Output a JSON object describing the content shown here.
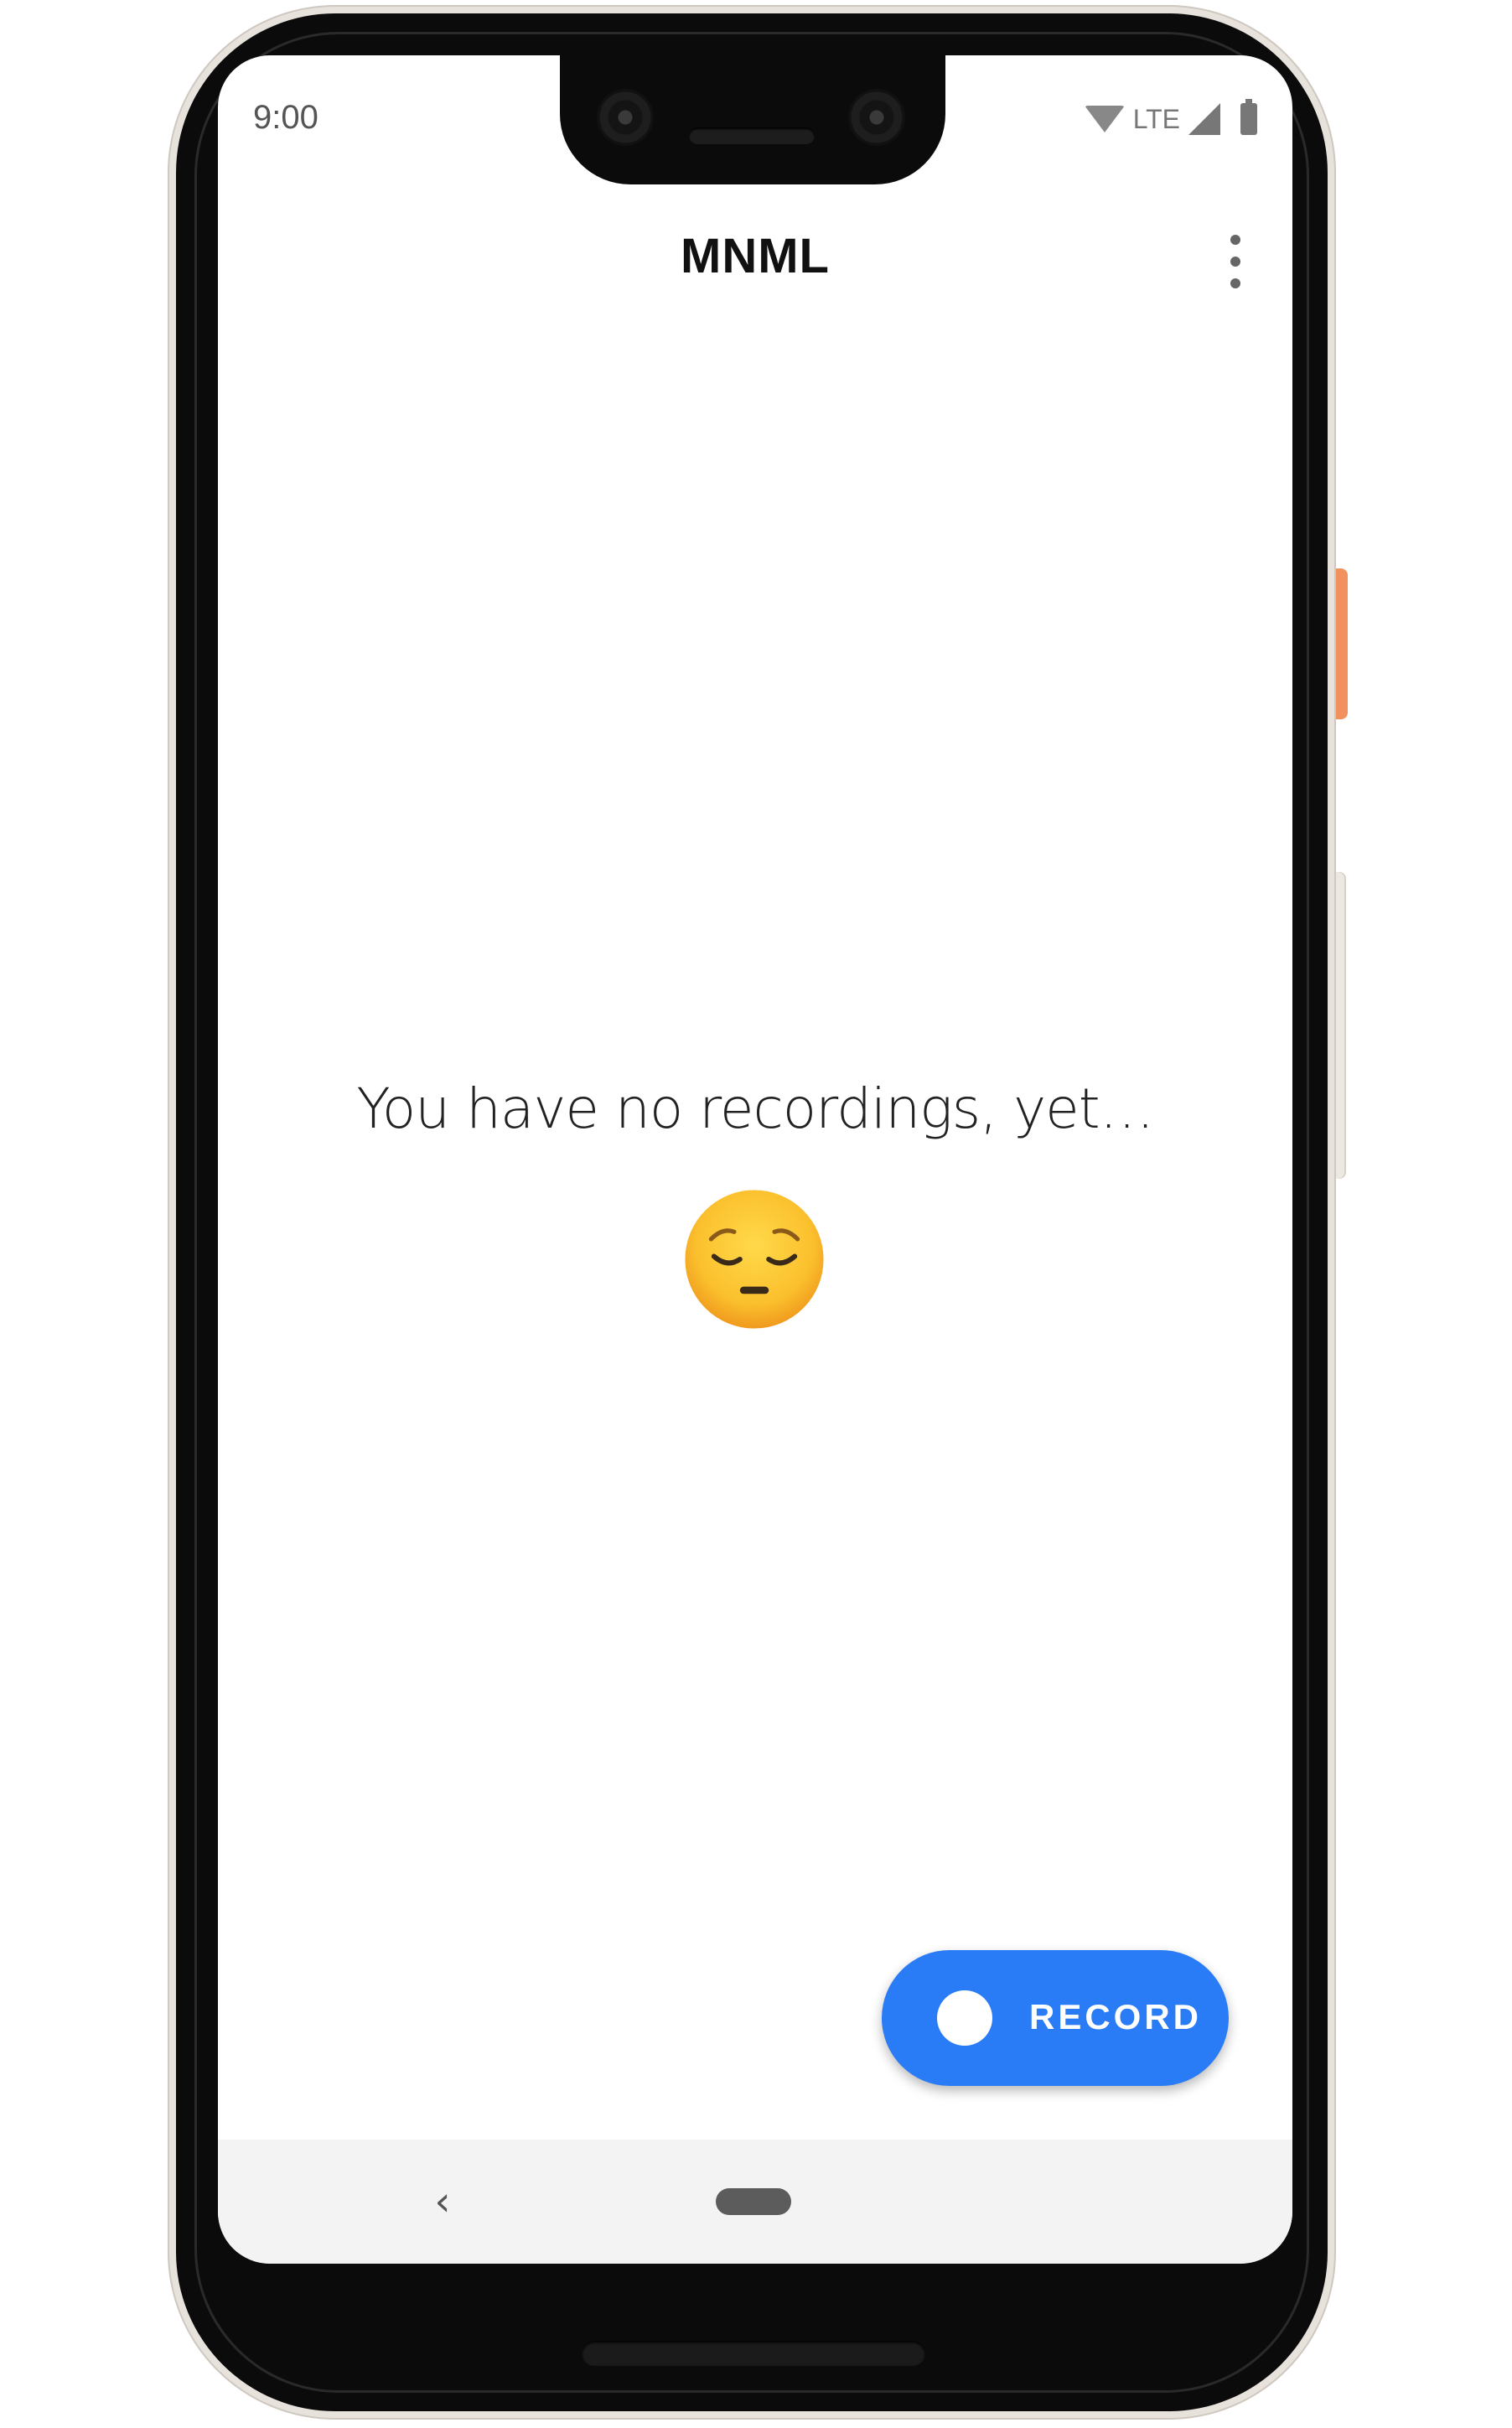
{
  "status_bar": {
    "time": "9:00",
    "network_label": "LTE",
    "icons": [
      "wifi-icon",
      "signal-icon",
      "battery-icon"
    ]
  },
  "app_bar": {
    "title": "MNML",
    "menu_icon": "more-vert-icon"
  },
  "empty_state": {
    "message": "You have no recordings, yet…",
    "emoji": "pensive-face-icon"
  },
  "record_button": {
    "label": "RECORD",
    "icon": "record-dot-icon"
  },
  "nav_bar": {
    "back_symbol": "‹",
    "icons": [
      "back-icon",
      "home-pill-icon"
    ]
  },
  "colors": {
    "accent": "#2a7bf6",
    "title_text": "#111111",
    "body_text": "#222222",
    "nav_background": "#f3f3f3",
    "phone_frame": "#e7e2dc",
    "side_button": "#f0915e"
  }
}
